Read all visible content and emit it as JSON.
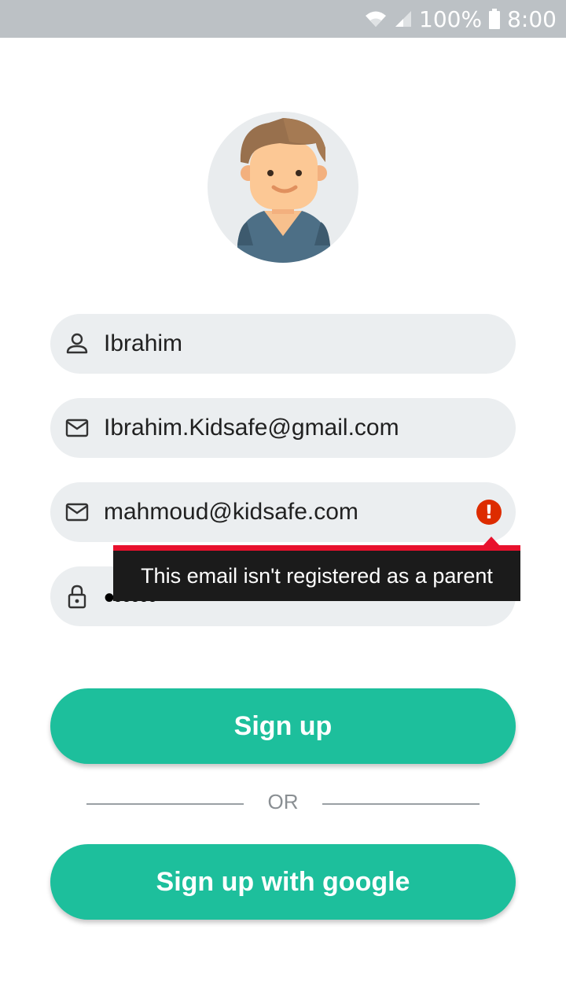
{
  "status_bar": {
    "battery": "100%",
    "time": "8:00",
    "icons": [
      "wifi-icon",
      "signal-icon",
      "battery-icon"
    ]
  },
  "avatar": {
    "icon": "boy-avatar-icon"
  },
  "form": {
    "name": {
      "value": "Ibrahim",
      "icon": "person-icon"
    },
    "email": {
      "value": "Ibrahim.Kidsafe@gmail.com",
      "icon": "mail-icon"
    },
    "parent_email": {
      "value": "mahmoud@kidsafe.com",
      "icon": "mail-icon",
      "error_icon": "!"
    },
    "password": {
      "value": "••••••",
      "icon": "lock-icon"
    }
  },
  "error_tooltip": {
    "text": "This email isn't registered as a parent"
  },
  "buttons": {
    "signup": "Sign up",
    "or": "OR",
    "google": "Sign up with google"
  },
  "colors": {
    "accent": "#1dbf9c",
    "error": "#dd2c00",
    "tooltip_border": "#e8112d",
    "field_bg": "#ebeef0",
    "status_bar": "#bcc1c5"
  }
}
